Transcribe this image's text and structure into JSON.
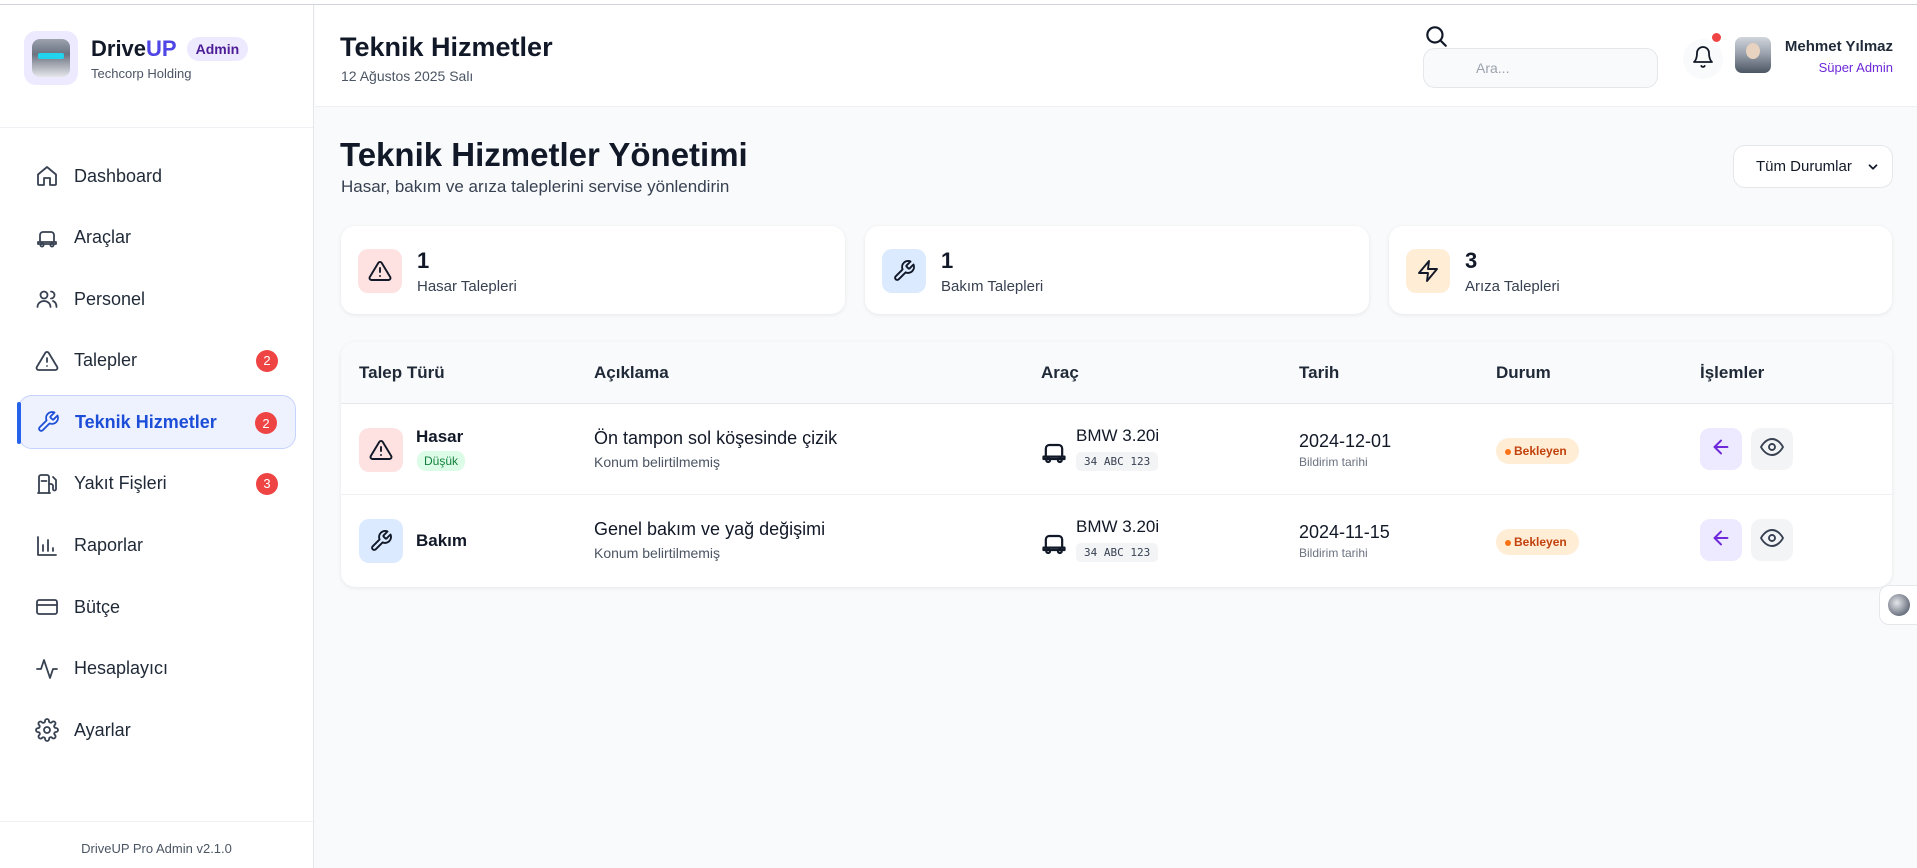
{
  "brand": {
    "name_a": "Drive",
    "name_b": "UP",
    "badge": "Admin",
    "subtitle": "Techcorp Holding"
  },
  "sidebar": {
    "items": [
      {
        "label": "Dashboard",
        "icon": "home-icon"
      },
      {
        "label": "Araçlar",
        "icon": "car-icon"
      },
      {
        "label": "Personel",
        "icon": "users-icon"
      },
      {
        "label": "Talepler",
        "icon": "alert-triangle-icon",
        "badge": "2"
      },
      {
        "label": "Teknik Hizmetler",
        "icon": "wrench-icon",
        "badge": "2",
        "active": true
      },
      {
        "label": "Yakıt Fişleri",
        "icon": "fuel-icon",
        "badge": "3"
      },
      {
        "label": "Raporlar",
        "icon": "bar-chart-icon"
      },
      {
        "label": "Bütçe",
        "icon": "credit-card-icon"
      },
      {
        "label": "Hesaplayıcı",
        "icon": "activity-icon"
      },
      {
        "label": "Ayarlar",
        "icon": "gear-icon"
      }
    ],
    "footer": "DriveUP Pro Admin v2.1.0"
  },
  "header": {
    "title": "Teknik Hizmetler",
    "date": "12 Ağustos 2025 Salı",
    "search_placeholder": "Ara...",
    "user_name": "Mehmet Yılmaz",
    "user_role": "Süper Admin"
  },
  "main": {
    "title": "Teknik Hizmetler Yönetimi",
    "subtitle": "Hasar, bakım ve arıza taleplerini servise yönlendirin",
    "filter_selected": "Tüm Durumlar",
    "stats": [
      {
        "value": "1",
        "label": "Hasar Talepleri",
        "icon": "alert-triangle-icon",
        "color": "#fee2e2"
      },
      {
        "value": "1",
        "label": "Bakım Talepleri",
        "icon": "wrench-icon",
        "color": "#dbeafe"
      },
      {
        "value": "3",
        "label": "Arıza Talepleri",
        "icon": "zap-icon",
        "color": "#ffedd5"
      }
    ],
    "table": {
      "headers": [
        "Talep Türü",
        "Açıklama",
        "Araç",
        "Tarih",
        "Durum",
        "İşlemler"
      ],
      "rows": [
        {
          "type": "Hasar",
          "priority": "Düşük",
          "desc": "Ön tampon sol köşesinde çizik",
          "location": "Konum belirtilmemiş",
          "car": "BMW 3.20i",
          "plate": "34 ABC 123",
          "date": "2024-12-01",
          "date_label": "Bildirim tarihi",
          "status": "Bekleyen"
        },
        {
          "type": "Bakım",
          "priority": "",
          "desc": "Genel bakım ve yağ değişimi",
          "location": "Konum belirtilmemiş",
          "car": "BMW 3.20i",
          "plate": "34 ABC 123",
          "date": "2024-11-15",
          "date_label": "Bildirim tarihi",
          "status": "Bekleyen"
        }
      ]
    }
  },
  "colors": {
    "accent": "#2563eb",
    "brand": "#4f46e5",
    "danger": "#ef4444",
    "pending": "#f97316",
    "success": "#15803d"
  }
}
